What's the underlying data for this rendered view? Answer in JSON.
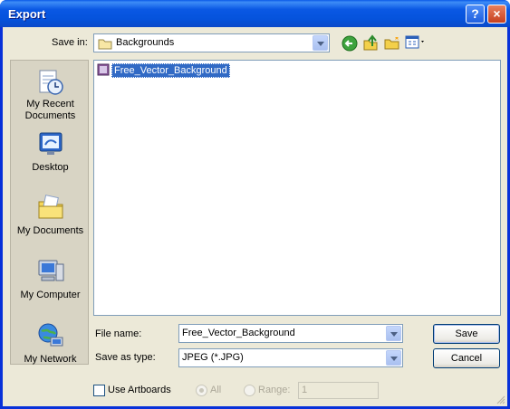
{
  "window": {
    "title": "Export",
    "help_label": "?",
    "close_label": "×"
  },
  "save_in": {
    "label": "Save in:",
    "value": "Backgrounds"
  },
  "toolbar": {
    "back_icon": "back-arrow-icon",
    "up_icon": "up-folder-icon",
    "new_folder_icon": "new-folder-icon",
    "views_icon": "view-menu-icon"
  },
  "places": [
    {
      "label": "My Recent\nDocuments",
      "icon": "recent-documents-icon"
    },
    {
      "label": "Desktop",
      "icon": "desktop-icon"
    },
    {
      "label": "My Documents",
      "icon": "my-documents-icon"
    },
    {
      "label": "My Computer",
      "icon": "my-computer-icon"
    },
    {
      "label": "My Network",
      "icon": "my-network-icon"
    }
  ],
  "files": [
    {
      "name": "Free_Vector_Background",
      "icon": "image-file-icon",
      "selected": true
    }
  ],
  "file_name": {
    "label": "File name:",
    "value": "Free_Vector_Background"
  },
  "save_as_type": {
    "label": "Save as type:",
    "value": "JPEG (*.JPG)"
  },
  "buttons": {
    "save": "Save",
    "cancel": "Cancel"
  },
  "options": {
    "use_artboards": "Use Artboards",
    "all": "All",
    "range": "Range:",
    "range_value": "1"
  },
  "colors": {
    "title_bar": "#0a58e4",
    "dialog_bg": "#ece9d8",
    "selection": "#316ac5"
  }
}
